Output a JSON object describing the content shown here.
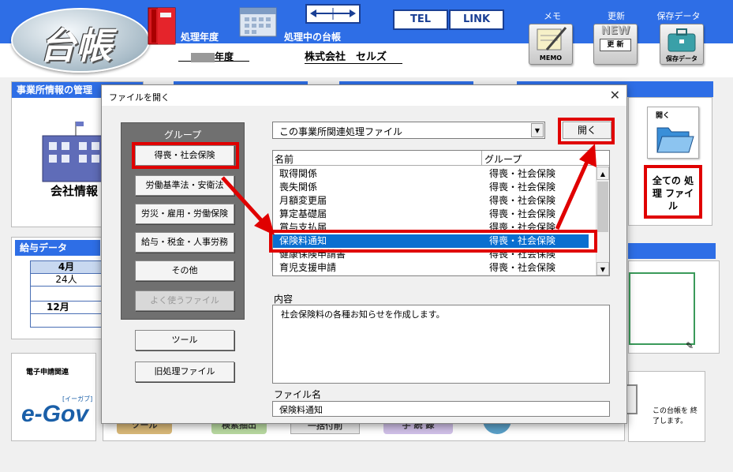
{
  "header": {
    "logo_text": "台帳",
    "fiscal_year_label": "処理年度",
    "fiscal_year_value": "年度",
    "current_ledger_label": "処理中の台帳",
    "company_name": "株式会社　セルズ",
    "tel_label": "TEL",
    "link_label": "LINK",
    "memo_label": "メモ",
    "memo_icon_text": "MEMO",
    "update_label": "更新",
    "update_icon_text": "更 新",
    "update_badge": "NEW",
    "save_label": "保存データ",
    "save_icon_text": "保存データ"
  },
  "background": {
    "office_panel_title": "事業所情報の管理",
    "company_info_label": "会社情報",
    "salary_panel_title": "給与データ",
    "month_1": "4月",
    "month_1_value": "24人",
    "month_2": "12月",
    "egov_caption": "電子申請関連",
    "egov_logo": "e-Gov",
    "egov_kana": "[イーガブ]",
    "bottom_buttons": [
      "ツール",
      "検索抽出",
      "一括付削",
      "手 続 録"
    ],
    "open_label": "開く",
    "all_files_label": "全ての 処 理 ファイル",
    "close_ledger_label": "この台帳を 終了します。"
  },
  "dialog": {
    "title": "ファイルを開く",
    "group_header": "グループ",
    "groups": [
      "得喪・社会保険",
      "労働基準法・安衛法",
      "労災・雇用・労働保険",
      "給与・税金・人事労務",
      "その他",
      "よく使うファイル"
    ],
    "tools_button": "ツール",
    "old_files_button": "旧処理ファイル",
    "filter_value": "この事業所関連処理ファイル",
    "open_button": "開く",
    "col_name": "名前",
    "col_group": "グループ",
    "files": [
      {
        "name": "取得関係",
        "group": "得喪・社会保険"
      },
      {
        "name": "喪失関係",
        "group": "得喪・社会保険"
      },
      {
        "name": "月額変更届",
        "group": "得喪・社会保険"
      },
      {
        "name": "算定基礎届",
        "group": "得喪・社会保険"
      },
      {
        "name": "賞与支払届",
        "group": "得喪・社会保険"
      },
      {
        "name": "保険料通知",
        "group": "得喪・社会保険"
      },
      {
        "name": "健康保険申請書",
        "group": "得喪・社会保険"
      },
      {
        "name": "育児支援申請",
        "group": "得喪・社会保険"
      }
    ],
    "content_label": "内容",
    "content_text": "社会保険料の各種お知らせを作成します。",
    "filename_label": "ファイル名",
    "filename_value": "保険料通知"
  },
  "colors": {
    "accent_blue": "#2e6ee6",
    "highlight_red": "#e00000",
    "selection_blue": "#0a6fd0"
  }
}
